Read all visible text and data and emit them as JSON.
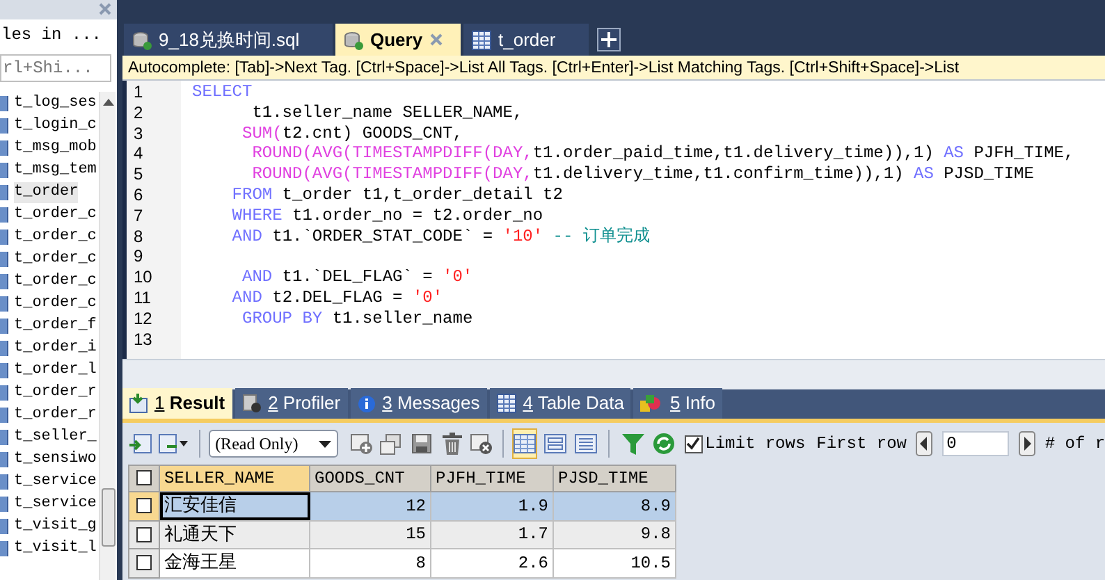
{
  "sidebar": {
    "header": "les in ...",
    "search": {
      "placeholder": "rl+Shi..."
    },
    "items": [
      {
        "label": "t_log_ses",
        "selected": false
      },
      {
        "label": "t_login_c",
        "selected": false
      },
      {
        "label": "t_msg_mob",
        "selected": false
      },
      {
        "label": "t_msg_tem",
        "selected": false
      },
      {
        "label": "t_order",
        "selected": true
      },
      {
        "label": "t_order_c",
        "selected": false
      },
      {
        "label": "t_order_c",
        "selected": false
      },
      {
        "label": "t_order_c",
        "selected": false
      },
      {
        "label": "t_order_c",
        "selected": false
      },
      {
        "label": "t_order_c",
        "selected": false
      },
      {
        "label": "t_order_f",
        "selected": false
      },
      {
        "label": "t_order_i",
        "selected": false
      },
      {
        "label": "t_order_l",
        "selected": false
      },
      {
        "label": "t_order_r",
        "selected": false
      },
      {
        "label": "t_order_r",
        "selected": false
      },
      {
        "label": "t_seller_",
        "selected": false
      },
      {
        "label": "t_sensiwo",
        "selected": false
      },
      {
        "label": "t_service",
        "selected": false
      },
      {
        "label": "t_service",
        "selected": false
      },
      {
        "label": "t_visit_g",
        "selected": false
      },
      {
        "label": "t_visit_l",
        "selected": false
      }
    ]
  },
  "editor_tabs": [
    {
      "label": "9_18兑换时间.sql",
      "kind": "file",
      "selected": false
    },
    {
      "label": "Query",
      "kind": "query",
      "selected": true
    },
    {
      "label": "t_order",
      "kind": "table",
      "selected": false
    }
  ],
  "autocomplete_hint": "Autocomplete: [Tab]->Next Tag. [Ctrl+Space]->List All Tags. [Ctrl+Enter]->List Matching Tags. [Ctrl+Shift+Space]->List",
  "code_lines": [
    {
      "number": "1",
      "tokens": [
        {
          "text": "SELECT",
          "kind": "keyword"
        }
      ]
    },
    {
      "number": "2",
      "tokens": [
        {
          "text": "      t1.seller_name SELLER_NAME,",
          "kind": "plain"
        }
      ]
    },
    {
      "number": "3",
      "tokens": [
        {
          "text": "     SUM(",
          "kind": "function"
        },
        {
          "text": "t2.cnt) GOODS_CNT,",
          "kind": "plain"
        }
      ]
    },
    {
      "number": "4",
      "tokens": [
        {
          "text": "      ROUND(AVG(TIMESTAMPDIFF(DAY,",
          "kind": "function"
        },
        {
          "text": "t1.order_paid_time,t1.delivery_time)),1) ",
          "kind": "plain"
        },
        {
          "text": "AS",
          "kind": "keyword"
        },
        {
          "text": " PJFH_TIME,",
          "kind": "plain"
        }
      ]
    },
    {
      "number": "5",
      "tokens": [
        {
          "text": "      ROUND(AVG(TIMESTAMPDIFF(DAY,",
          "kind": "function"
        },
        {
          "text": "t1.delivery_time,t1.confirm_time)),1) ",
          "kind": "plain"
        },
        {
          "text": "AS",
          "kind": "keyword"
        },
        {
          "text": " PJSD_TIME",
          "kind": "plain"
        }
      ]
    },
    {
      "number": "6",
      "tokens": [
        {
          "text": "    FROM",
          "kind": "keyword"
        },
        {
          "text": " t_order t1,t_order_detail t2",
          "kind": "plain"
        }
      ]
    },
    {
      "number": "7",
      "tokens": [
        {
          "text": "    WHERE",
          "kind": "keyword"
        },
        {
          "text": " t1.order_no = t2.order_no",
          "kind": "plain"
        }
      ]
    },
    {
      "number": "8",
      "tokens": [
        {
          "text": "    AND",
          "kind": "keyword"
        },
        {
          "text": " t1.`ORDER_STAT_CODE` = ",
          "kind": "plain"
        },
        {
          "text": "'10'",
          "kind": "string"
        },
        {
          "text": " -- 订单完成",
          "kind": "comment"
        }
      ]
    },
    {
      "number": "9"
    },
    {
      "number": "10",
      "tokens": [
        {
          "text": "     AND",
          "kind": "keyword"
        },
        {
          "text": " t1.`DEL_FLAG` = ",
          "kind": "plain"
        },
        {
          "text": "'0'",
          "kind": "string"
        }
      ]
    },
    {
      "number": "11",
      "tokens": [
        {
          "text": "    AND",
          "kind": "keyword"
        },
        {
          "text": " t2.DEL_FLAG = ",
          "kind": "plain"
        },
        {
          "text": "'0'",
          "kind": "string"
        }
      ]
    },
    {
      "number": "12",
      "tokens": [
        {
          "text": "     GROUP BY",
          "kind": "keyword"
        },
        {
          "text": " t1.seller_name",
          "kind": "plain"
        }
      ]
    },
    {
      "number": "13"
    }
  ],
  "result_tabs": [
    {
      "number": "1",
      "label": "Result",
      "kind": "result",
      "selected": true
    },
    {
      "number": "2",
      "label": "Profiler",
      "kind": "profiler",
      "selected": false
    },
    {
      "number": "3",
      "label": "Messages",
      "kind": "messages",
      "selected": false
    },
    {
      "number": "4",
      "label": "Table Data",
      "kind": "tabledata",
      "selected": false
    },
    {
      "number": "5",
      "label": "Info",
      "kind": "info",
      "selected": false
    }
  ],
  "result_toolbar": {
    "mode_dropdown": "(Read Only)",
    "limit_rows": {
      "label": "Limit rows",
      "checked": true
    },
    "first_row_label": "First row",
    "first_row_value": "0",
    "rows_label": "# of r"
  },
  "table": {
    "select_all_checked": false,
    "columns": [
      "SELLER_NAME",
      "GOODS_CNT",
      "PJFH_TIME",
      "PJSD_TIME"
    ],
    "rows": [
      {
        "cells": [
          "汇安佳信",
          "12",
          "1.9",
          "8.9"
        ],
        "selected": true,
        "checked": false
      },
      {
        "cells": [
          "礼通天下",
          "15",
          "1.7",
          "9.8"
        ],
        "selected": false,
        "checked": false
      },
      {
        "cells": [
          "金海王星",
          "8",
          "2.6",
          "10.5"
        ],
        "selected": false,
        "checked": false
      }
    ]
  }
}
